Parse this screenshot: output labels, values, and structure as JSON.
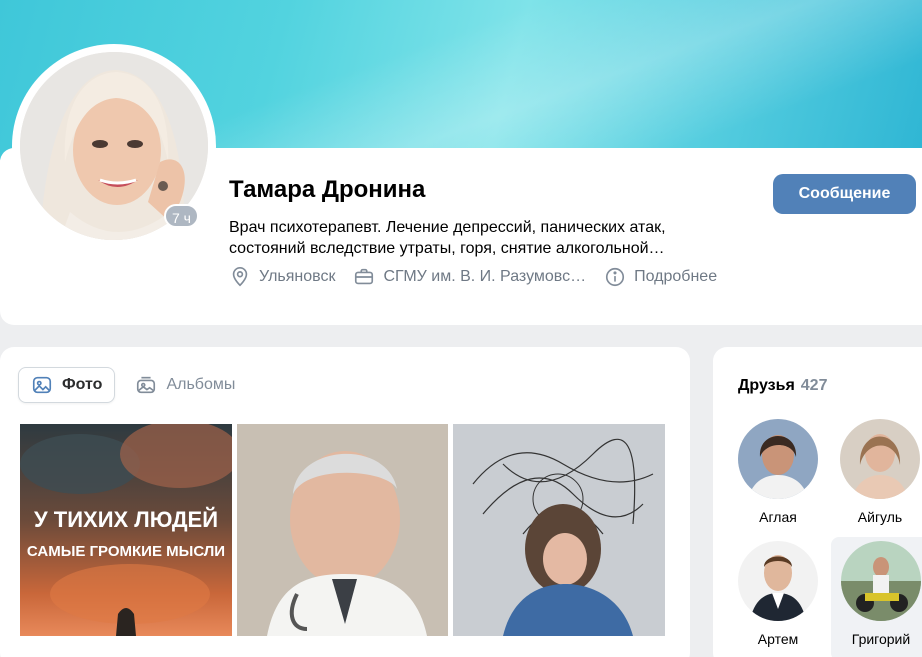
{
  "profile": {
    "name": "Тамара Дронина",
    "online_badge": "7 ч",
    "bio_line1": "Врач психотерапевт. Лечение депрессий, панических атак,",
    "bio_line2": "состояний вследствие утраты, горя, снятие алкогольной…",
    "location": "Ульяновск",
    "education": "СГМУ им. В. И. Разумовс…",
    "more": "Подробнее",
    "message_button": "Сообщение"
  },
  "photos": {
    "tabs": [
      {
        "label": "Фото",
        "icon": "image-icon",
        "active": true
      },
      {
        "label": "Альбомы",
        "icon": "albums-icon",
        "active": false
      }
    ],
    "photo1_text_line1": "У ТИХИХ ЛЮДЕЙ",
    "photo1_text_line2": "САМЫЕ ГРОМКИЕ МЫСЛИ"
  },
  "friends": {
    "title": "Друзья",
    "count": "427",
    "items": [
      {
        "name": "Аглая"
      },
      {
        "name": "Айгуль"
      },
      {
        "name": "Артем"
      },
      {
        "name": "Григорий"
      }
    ]
  },
  "colors": {
    "accent": "#5181b8",
    "muted_text": "#6f7985",
    "cover": "#4fd0df"
  }
}
